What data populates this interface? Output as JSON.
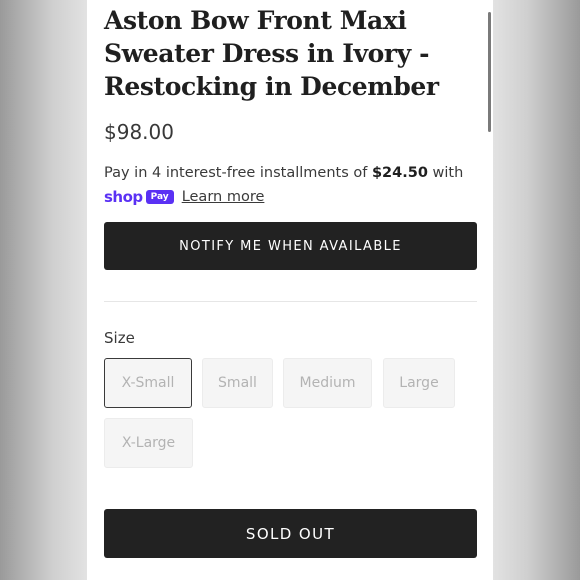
{
  "product": {
    "title": "Aston Bow Front Maxi Sweater Dress in Ivory - Restocking in December",
    "price": "$98.00"
  },
  "installments": {
    "prefix": "Pay in 4 interest-free installments of ",
    "amount": "$24.50",
    "suffix": " with",
    "shop_logo": "shop",
    "pay_badge": "Pay",
    "learn_more": "Learn more"
  },
  "buttons": {
    "notify": "NOTIFY ME WHEN AVAILABLE",
    "sold_out": "SOLD OUT"
  },
  "size": {
    "label": "Size",
    "selected": "X-Small",
    "options": [
      "X-Small",
      "Small",
      "Medium",
      "Large",
      "X-Large"
    ]
  },
  "colors": {
    "button_bg": "#222222",
    "shop_pay_purple": "#5a31f4"
  }
}
